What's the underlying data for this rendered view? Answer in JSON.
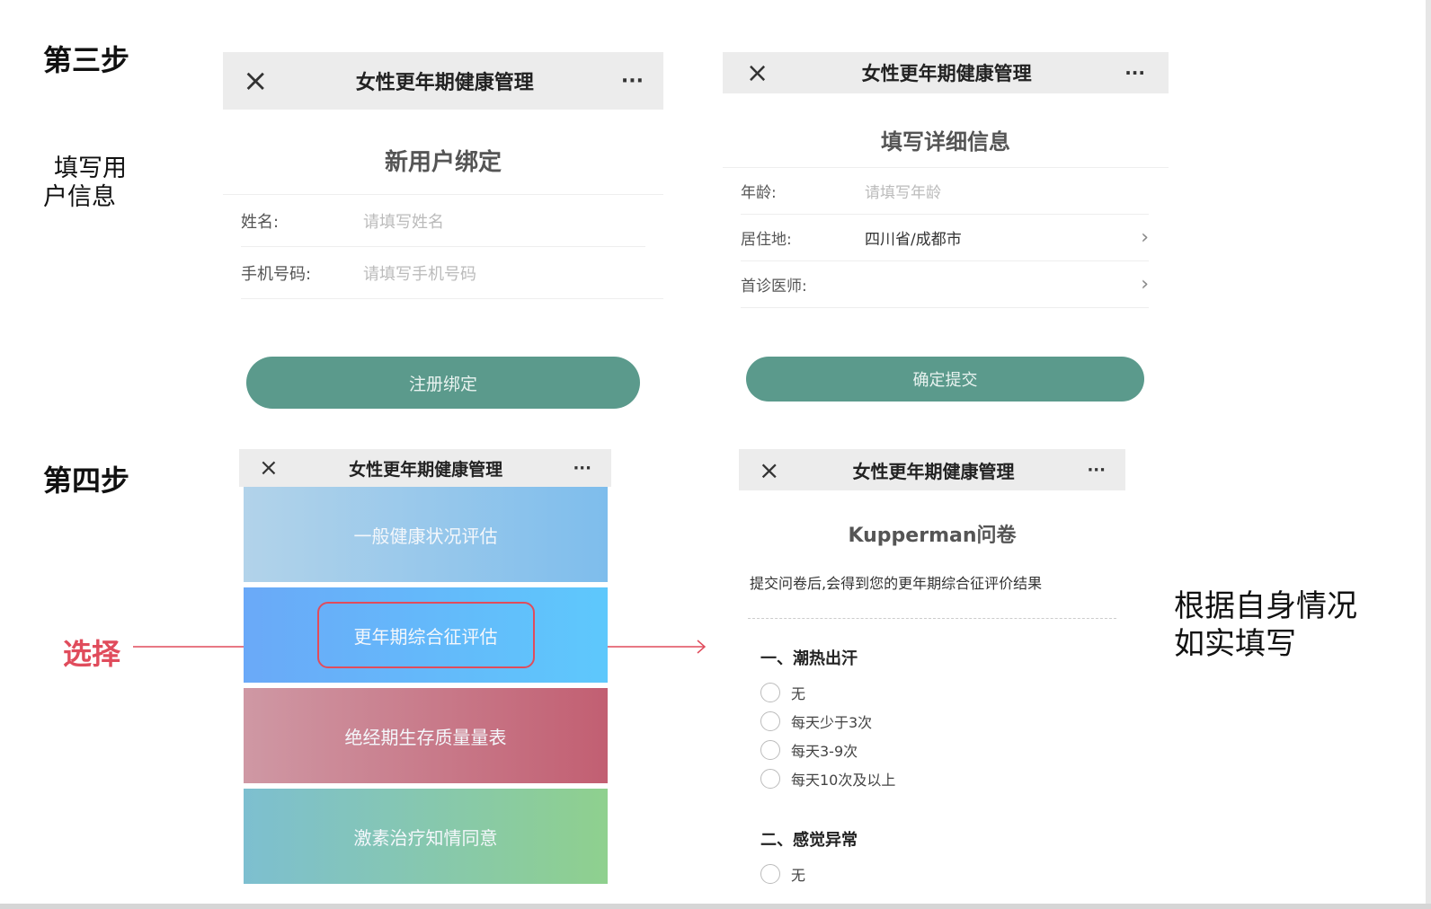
{
  "step3": {
    "title": "第三步",
    "note": [
      "填写用",
      "户信息"
    ]
  },
  "step4": {
    "title": "第四步",
    "select_label": "选择"
  },
  "right_note": [
    "根据自身情况",
    "如实填写"
  ],
  "app_title": "女性更年期健康管理",
  "icons": {
    "close": "×",
    "more": "···",
    "chevron": "›"
  },
  "screen_bind": {
    "title": "新用户绑定",
    "fields": [
      {
        "label": "姓名:",
        "placeholder": "请填写姓名"
      },
      {
        "label": "手机号码:",
        "placeholder": "请填写手机号码"
      }
    ],
    "button": "注册绑定"
  },
  "screen_detail": {
    "title": "填写详细信息",
    "fields": [
      {
        "label": "年龄:",
        "placeholder": "请填写年龄"
      },
      {
        "label": "居住地:",
        "value": "四川省/成都市"
      },
      {
        "label": "首诊医师:",
        "value": ""
      }
    ],
    "button": "确定提交"
  },
  "screen_menu": {
    "items": [
      {
        "label": "一般健康状况评估",
        "color_from": "#b2d3ea",
        "color_to": "#7ebdec"
      },
      {
        "label": "更年期综合征评估",
        "color_from": "#6aa9f8",
        "color_to": "#5ec8fc"
      },
      {
        "label": "绝经期生存质量量表",
        "color_from": "#cf98a4",
        "color_to": "#c25f72"
      },
      {
        "label": "激素治疗知情同意",
        "color_from": "#7dbfd0",
        "color_to": "#8fd08e"
      }
    ],
    "highlight_color": "#e04c5c"
  },
  "screen_questionnaire": {
    "title": "Kupperman问卷",
    "subtitle": "提交问卷后,会得到您的更年期综合征评价结果",
    "sections": [
      {
        "title": "一、潮热出汗",
        "options": [
          "无",
          "每天少于3次",
          "每天3-9次",
          "每天10次及以上"
        ]
      },
      {
        "title": "二、感觉异常",
        "options": [
          "无"
        ]
      }
    ]
  }
}
